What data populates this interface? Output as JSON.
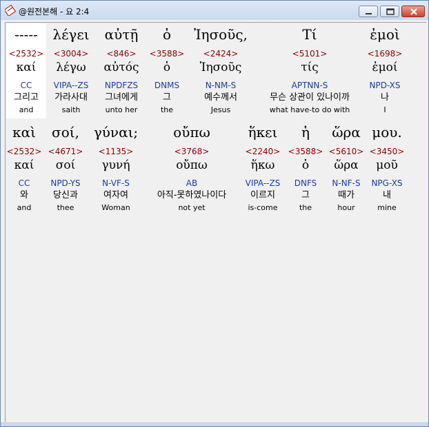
{
  "window": {
    "title": "@원전본해 - 요 2:4"
  },
  "rows": [
    {
      "words": [
        {
          "greek": "-----",
          "strong": "<2532>",
          "lemma": "καί",
          "parse": "CC",
          "korean": "그리고",
          "english": "and",
          "highlighted": true
        },
        {
          "greek": "λέγει",
          "strong": "<3004>",
          "lemma": "λέγω",
          "parse": "VIPA--ZS",
          "korean": "가라사대",
          "english": "saith"
        },
        {
          "greek": "αὐτῇ",
          "strong": "<846>",
          "lemma": "αὐτός",
          "parse": "NPDFZS",
          "korean": "그녀에게",
          "english": "unto her"
        },
        {
          "greek": "ὁ",
          "strong": "<3588>",
          "lemma": "ὁ",
          "parse": "DNMS",
          "korean": "그",
          "english": "the"
        },
        {
          "greek": "Ἰησοῦς,",
          "strong": "<2424>",
          "lemma": "Ἰησοῦς",
          "parse": "N-NM-S",
          "korean": "예수께서",
          "english": "Jesus"
        },
        {
          "greek": "Τί",
          "strong": "<5101>",
          "lemma": "τίς",
          "parse": "APTNN-S",
          "korean": "무슨 상관이 있나이까",
          "english": "what have-to do with"
        },
        {
          "greek": "ἐμοὶ",
          "strong": "<1698>",
          "lemma": "ἐμοί",
          "parse": "NPD-XS",
          "korean": "나",
          "english": "I"
        }
      ]
    },
    {
      "words": [
        {
          "greek": "καὶ",
          "strong": "<2532>",
          "lemma": "καί",
          "parse": "CC",
          "korean": "와",
          "english": "and"
        },
        {
          "greek": "σοί,",
          "strong": "<4671>",
          "lemma": "σοί",
          "parse": "NPD-YS",
          "korean": "당신과",
          "english": "thee"
        },
        {
          "greek": "γύναι;",
          "strong": "<1135>",
          "lemma": "γυνή",
          "parse": "N-VF-S",
          "korean": "여자여",
          "english": "Woman"
        },
        {
          "greek": "οὔπω",
          "strong": "<3768>",
          "lemma": "οὔπω",
          "parse": "AB",
          "korean": "아직-못하였나이다",
          "english": "not yet"
        },
        {
          "greek": "ἥκει",
          "strong": "<2240>",
          "lemma": "ἥκω",
          "parse": "VIPA--ZS",
          "korean": "이르지",
          "english": "is-come"
        },
        {
          "greek": "ἡ",
          "strong": "<3588>",
          "lemma": "ὁ",
          "parse": "DNFS",
          "korean": "그",
          "english": "the"
        },
        {
          "greek": "ὥρα",
          "strong": "<5610>",
          "lemma": "ὥρα",
          "parse": "N-NF-S",
          "korean": "때가",
          "english": "hour"
        },
        {
          "greek": "μου.",
          "strong": "<3450>",
          "lemma": "μοῦ",
          "parse": "NPG-XS",
          "korean": "내",
          "english": "mine"
        }
      ]
    }
  ]
}
